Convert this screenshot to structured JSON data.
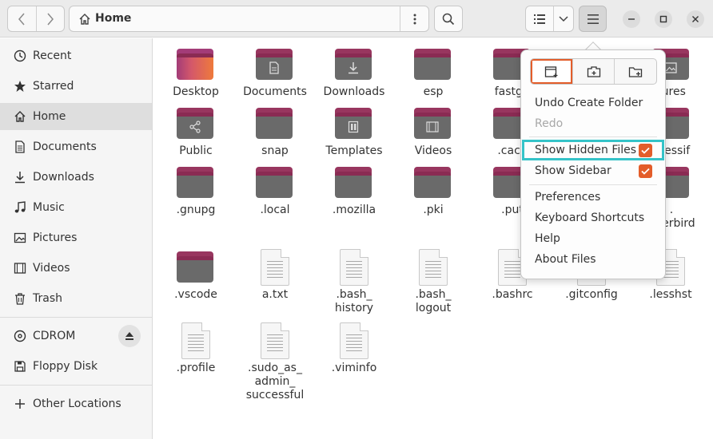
{
  "header": {
    "path_label": "Home",
    "icons": {
      "back": "chevron-left-icon",
      "forward": "chevron-right-icon",
      "home": "home-icon",
      "path_menu": "vertical-dots-icon",
      "search": "search-icon",
      "list_view": "list-view-icon",
      "view_options": "chevron-down-icon",
      "main_menu": "hamburger-icon",
      "minimize": "minimize-icon",
      "maximize": "maximize-icon",
      "close": "close-icon"
    }
  },
  "sidebar": {
    "items": [
      {
        "label": "Recent",
        "icon": "clock-icon"
      },
      {
        "label": "Starred",
        "icon": "star-icon"
      },
      {
        "label": "Home",
        "icon": "home-icon",
        "active": true
      },
      {
        "label": "Documents",
        "icon": "document-icon"
      },
      {
        "label": "Downloads",
        "icon": "download-icon"
      },
      {
        "label": "Music",
        "icon": "music-icon"
      },
      {
        "label": "Pictures",
        "icon": "picture-icon"
      },
      {
        "label": "Videos",
        "icon": "video-icon"
      },
      {
        "label": "Trash",
        "icon": "trash-icon"
      }
    ],
    "devices": [
      {
        "label": "CDROM",
        "icon": "disc-icon",
        "eject_icon": "eject-icon"
      },
      {
        "label": "Floppy Disk",
        "icon": "floppy-icon"
      }
    ],
    "other": {
      "label": "Other Locations",
      "icon": "plus-icon"
    }
  },
  "files": {
    "row1": [
      {
        "name": "Desktop",
        "type": "folder-desktop"
      },
      {
        "name": "Documents",
        "type": "folder",
        "emblem": "document-emblem-icon"
      },
      {
        "name": "Downloads",
        "type": "folder",
        "emblem": "download-emblem-icon"
      },
      {
        "name": "esp",
        "type": "folder"
      },
      {
        "name": "fastgit",
        "type": "folder"
      },
      {
        "name": "tures",
        "type": "folder",
        "emblem": "picture-emblem-icon"
      }
    ],
    "row2": [
      {
        "name": "Public",
        "type": "folder",
        "emblem": "share-emblem-icon"
      },
      {
        "name": "snap",
        "type": "folder"
      },
      {
        "name": "Templates",
        "type": "folder",
        "emblem": "template-emblem-icon"
      },
      {
        "name": "Videos",
        "type": "folder",
        "emblem": "video-emblem-icon"
      },
      {
        "name": ".cach",
        "type": "folder"
      },
      {
        "name": "pressif",
        "type": "folder"
      }
    ],
    "row3": [
      {
        "name": ".gnupg",
        "type": "folder"
      },
      {
        "name": ".local",
        "type": "folder"
      },
      {
        "name": ".mozilla",
        "type": "folder"
      },
      {
        "name": ".pki",
        "type": "folder"
      },
      {
        "name": ".put",
        "type": "folder"
      },
      {
        "name": "nderbird",
        "type": "folder",
        "prefix": "."
      }
    ],
    "row4": [
      {
        "name": ".vscode",
        "type": "folder"
      },
      {
        "name": "a.txt",
        "type": "doc"
      },
      {
        "name": ".bash_\nhistory",
        "type": "doc"
      },
      {
        "name": ".bash_\nlogout",
        "type": "doc"
      },
      {
        "name": ".bashrc",
        "type": "doc"
      },
      {
        "name": ".gitconfig",
        "type": "doc"
      },
      {
        "name": ".lesshst",
        "type": "doc"
      }
    ],
    "row5": [
      {
        "name": ".profile",
        "type": "doc"
      },
      {
        "name": ".sudo_as_\nadmin_\nsuccessful",
        "type": "doc"
      },
      {
        "name": ".viminfo",
        "type": "doc"
      }
    ]
  },
  "popover": {
    "top_buttons": [
      {
        "icon": "new-window-icon"
      },
      {
        "icon": "new-tab-icon"
      },
      {
        "icon": "new-folder-icon"
      }
    ],
    "items": {
      "undo": "Undo Create Folder",
      "redo": "Redo",
      "show_hidden": "Show Hidden Files",
      "show_sidebar": "Show Sidebar",
      "preferences": "Preferences",
      "shortcuts": "Keyboard Shortcuts",
      "help": "Help",
      "about": "About Files"
    },
    "show_hidden_checked": true,
    "show_sidebar_checked": true,
    "accent": "#e35d2a",
    "highlight": "#35c3c8"
  }
}
